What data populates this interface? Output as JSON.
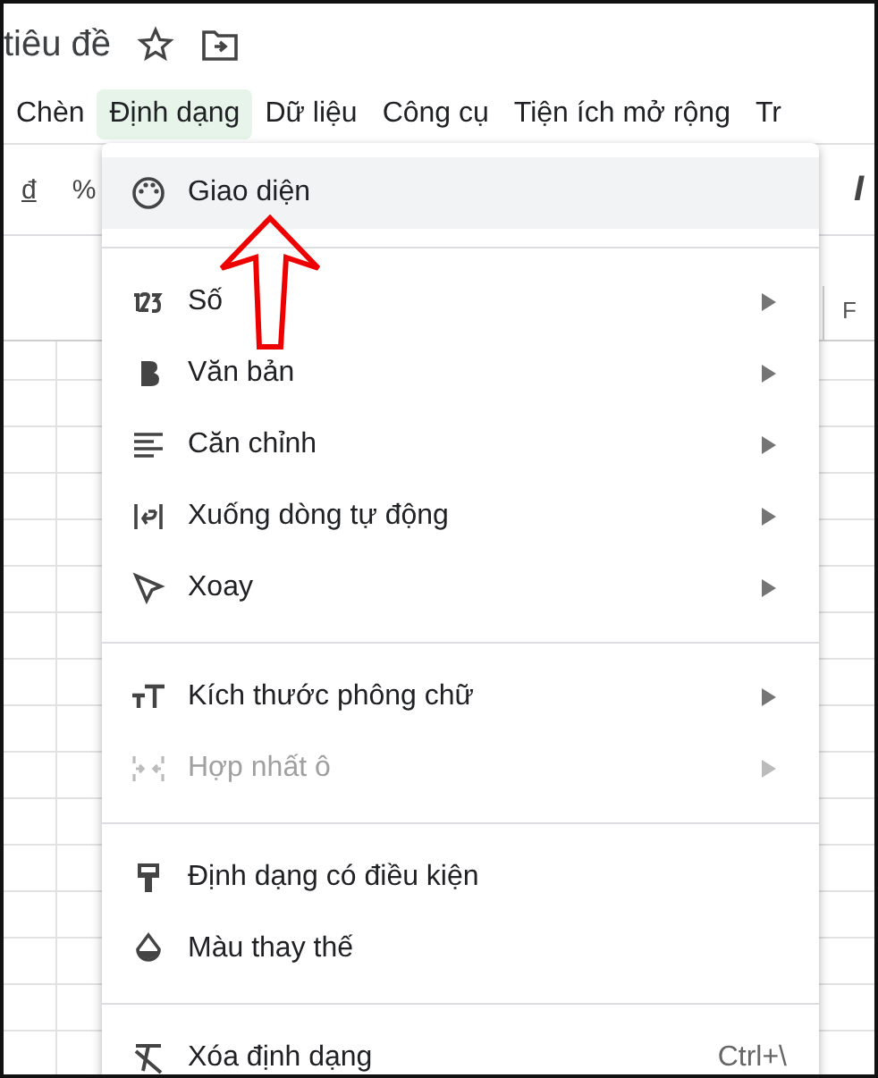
{
  "title": "tiêu đề",
  "menubar": [
    {
      "label": "Chèn",
      "selected": false
    },
    {
      "label": "Định dạng",
      "selected": true
    },
    {
      "label": "Dữ liệu",
      "selected": false
    },
    {
      "label": "Công cụ",
      "selected": false
    },
    {
      "label": "Tiện ích mở rộng",
      "selected": false
    },
    {
      "label": "Tr",
      "selected": false
    }
  ],
  "toolbar": [
    {
      "label": "đ",
      "kind": "currency"
    },
    {
      "label": "%",
      "kind": "plain"
    },
    {
      "label": "I",
      "kind": "italic"
    }
  ],
  "column_headers": [
    "F"
  ],
  "menu": {
    "sections": [
      [
        {
          "label": "Giao diện",
          "selected": true,
          "disabled": false,
          "submenu": false
        }
      ],
      [
        {
          "label": "Số",
          "selected": false,
          "disabled": false,
          "submenu": true
        },
        {
          "label": "Văn bản",
          "selected": false,
          "disabled": false,
          "submenu": true
        },
        {
          "label": "Căn chỉnh",
          "selected": false,
          "disabled": false,
          "submenu": true
        },
        {
          "label": "Xuống dòng tự động",
          "selected": false,
          "disabled": false,
          "submenu": true
        },
        {
          "label": "Xoay",
          "selected": false,
          "disabled": false,
          "submenu": true
        }
      ],
      [
        {
          "label": "Kích thước phông chữ",
          "selected": false,
          "disabled": false,
          "submenu": true
        },
        {
          "label": "Hợp nhất ô",
          "selected": false,
          "disabled": true,
          "submenu": true
        }
      ],
      [
        {
          "label": "Định dạng có điều kiện",
          "selected": false,
          "disabled": false,
          "submenu": false
        },
        {
          "label": "Màu thay thế",
          "selected": false,
          "disabled": false,
          "submenu": false
        }
      ],
      [
        {
          "label": "Xóa định dạng",
          "selected": false,
          "disabled": false,
          "submenu": false,
          "shortcut": "Ctrl+\\"
        }
      ]
    ]
  }
}
